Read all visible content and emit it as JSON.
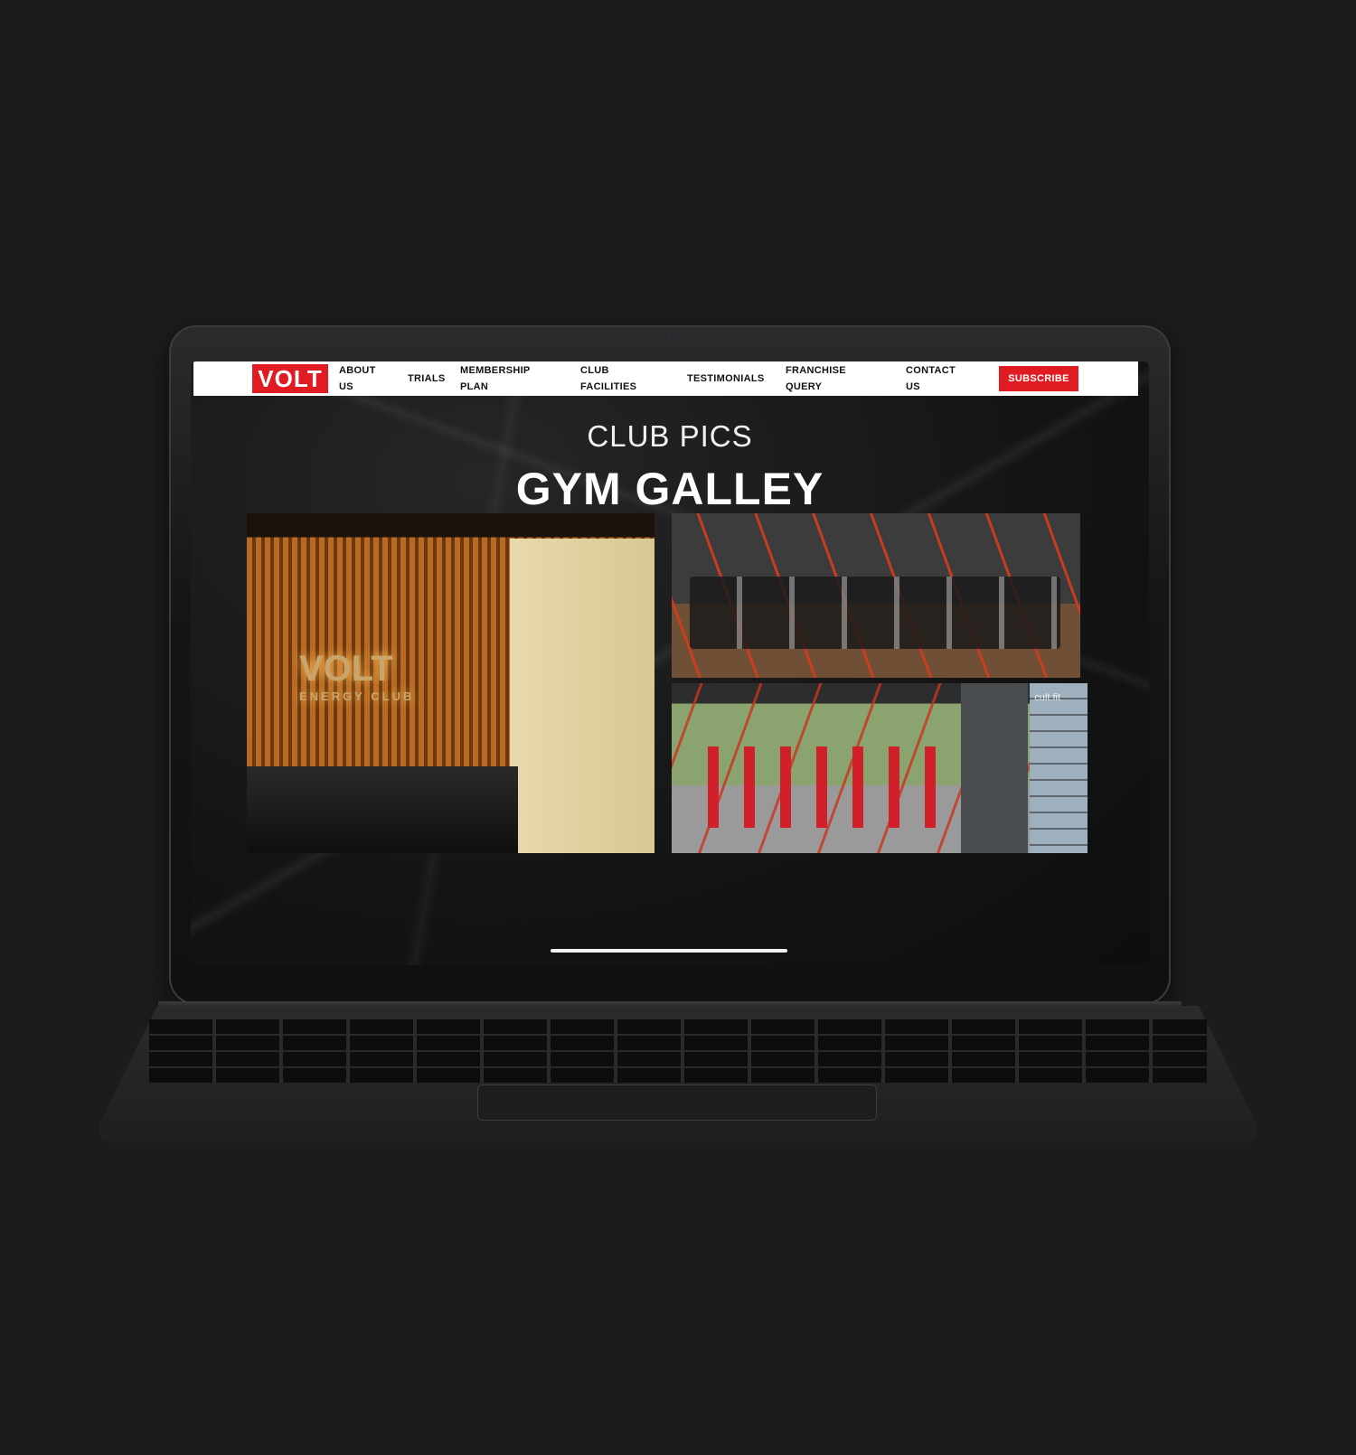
{
  "nav": {
    "logo": "VOLT",
    "items": [
      {
        "label": "ABOUT\nUS"
      },
      {
        "label": "TRIALS"
      },
      {
        "label": "MEMBERSHIP\nPLAN"
      },
      {
        "label": "CLUB\nFACILITIES"
      },
      {
        "label": "TESTIMONIALS"
      },
      {
        "label": "FRANCHISE\nQUERY"
      },
      {
        "label": "CONTACT\nUS"
      }
    ],
    "subscribe": "SUBSCRIBE"
  },
  "gallery": {
    "subtitle": "CLUB PICS",
    "title": "GYM GALLEY",
    "reception_sign": "VOLT",
    "reception_sign_sub": "ENERGY CLUB",
    "watermark": "cult.fit"
  },
  "colors": {
    "brand_red": "#e11b22",
    "background": "#1b1c1e"
  }
}
